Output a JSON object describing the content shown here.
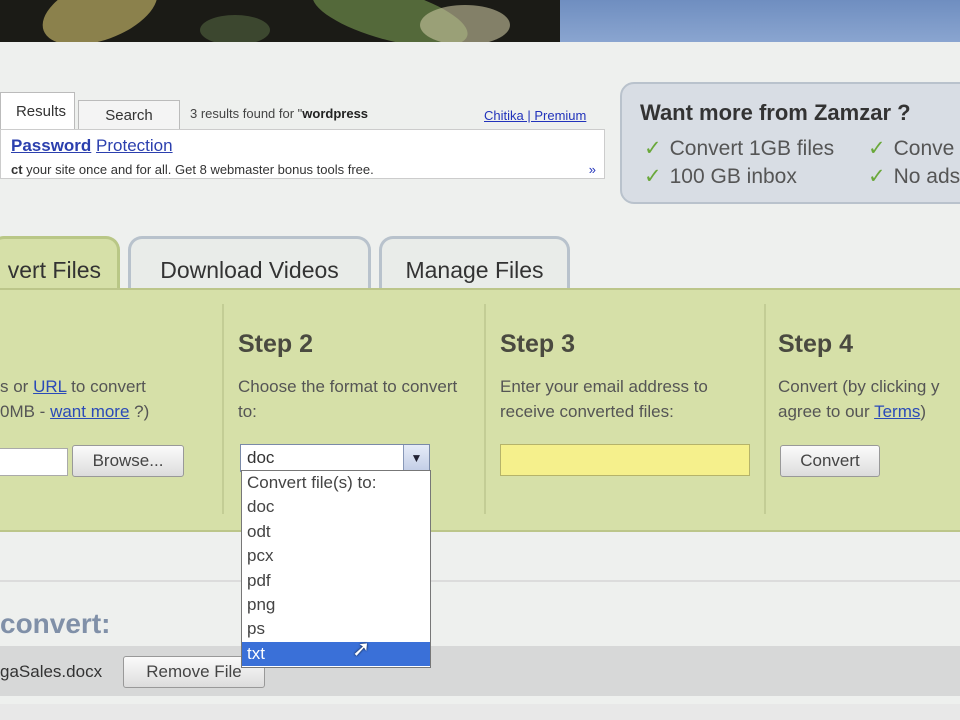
{
  "search_widget": {
    "tab_results": "Results",
    "tab_search": "Search",
    "results_prefix": "3 results found for \"",
    "results_query": "wordpress",
    "premium_link": "Chitika | Premium",
    "result_title_bold": "Password",
    "result_title_rest": "Protection",
    "result_desc_bold": "ct",
    "result_desc_rest": " your site once and for all. Get 8 webmaster bonus tools free.",
    "result_more": "»"
  },
  "promo": {
    "title": "Want more from Zamzar ?",
    "items": [
      "Convert 1GB files",
      "100 GB inbox",
      "Conve",
      "No ads"
    ],
    "check_color": "#6aa83a"
  },
  "tabs": {
    "convert": "vert Files",
    "download": "Download Videos",
    "manage": "Manage Files"
  },
  "steps": {
    "step1": {
      "text_pre": "s or ",
      "url_link": "URL",
      "text_mid": " to convert",
      "line2_pre": "0MB - ",
      "want_more": "want more",
      "line2_post": " ?)",
      "browse": "Browse..."
    },
    "step2": {
      "title": "Step 2",
      "text": "Choose the format to convert to:",
      "selected": "doc"
    },
    "step3": {
      "title": "Step 3",
      "text": "Enter your email address to receive converted files:"
    },
    "step4": {
      "title": "Step 4",
      "text_pre": "Convert (by clicking y",
      "line2_pre": "agree to our ",
      "terms": "Terms",
      "line2_post": ")",
      "convert_button": "Convert"
    }
  },
  "format_dropdown": {
    "options": [
      "Convert file(s) to:",
      "doc",
      "odt",
      "pcx",
      "pdf",
      "png",
      "ps",
      "txt"
    ],
    "highlighted": "txt"
  },
  "files": {
    "heading": "convert:",
    "file_name": "gaSales.docx",
    "remove_button": "Remove File"
  },
  "colors": {
    "panel_bg": "#d6e0a8",
    "email_bg": "#f5f08c",
    "link": "#2a4ab8",
    "highlight": "#3a70d8"
  }
}
